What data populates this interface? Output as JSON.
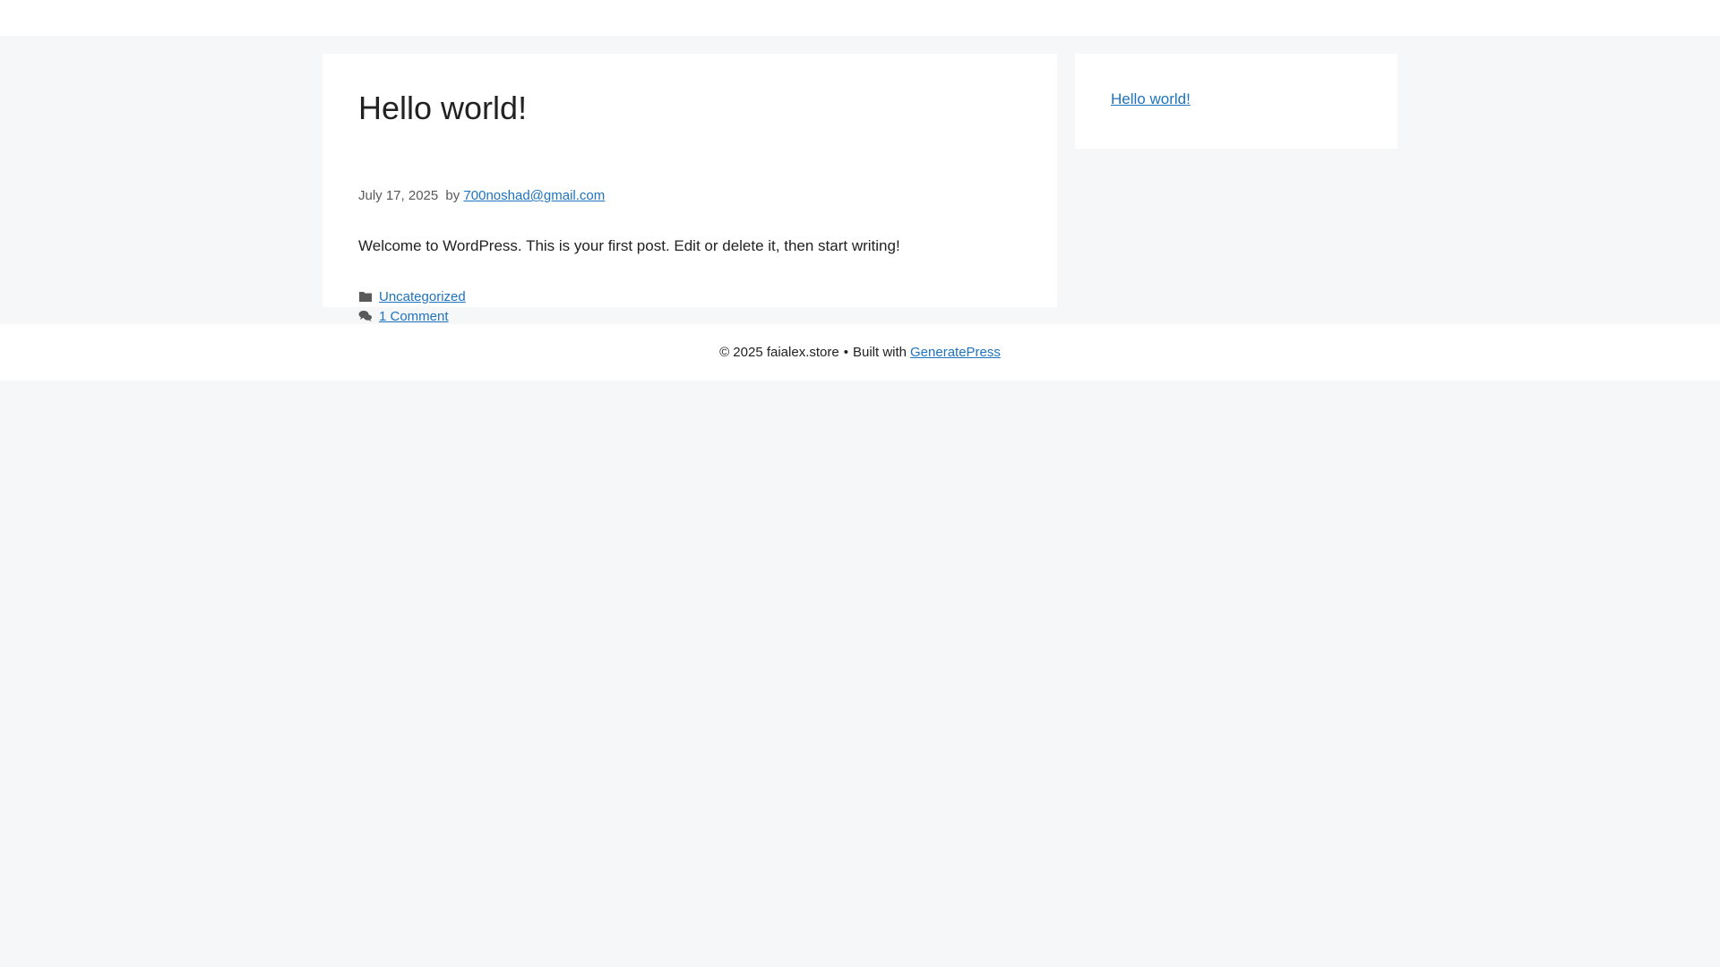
{
  "header": {},
  "post": {
    "title": "Hello world!",
    "date": "July 17, 2025",
    "by_label": "by",
    "author": "700noshad@gmail.com",
    "content": "Welcome to WordPress. This is your first post. Edit or delete it, then start writing!",
    "category": "Uncategorized",
    "comments": "1 Comment",
    "category_icon": "folder-icon",
    "comments_icon": "comments-icon"
  },
  "sidebar": {
    "recent_post": "Hello world!"
  },
  "footer": {
    "copyright": "© 2025 faialex.store",
    "separator": "•",
    "built_with": "Built with",
    "theme_link": "GeneratePress"
  },
  "colors": {
    "link": "#1e73be",
    "background": "#f6f7f9",
    "surface": "#ffffff",
    "text": "#222222",
    "meta": "#595959"
  }
}
